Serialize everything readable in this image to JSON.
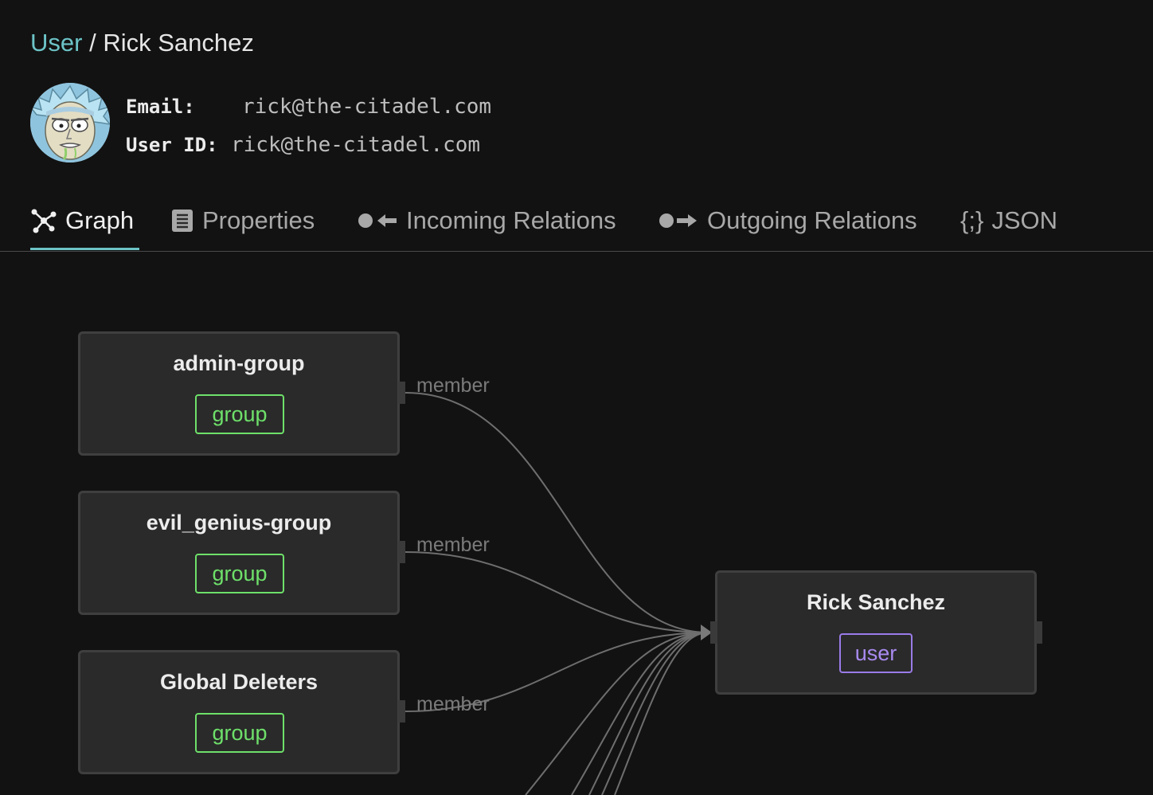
{
  "breadcrumb": {
    "parent": "User",
    "separator": "/",
    "current": "Rick Sanchez"
  },
  "profile": {
    "email_label": "Email:",
    "email_value": "rick@the-citadel.com",
    "userid_label": "User ID:",
    "userid_value": "rick@the-citadel.com"
  },
  "tabs": [
    {
      "label": "Graph",
      "icon": "graph-nodes-icon",
      "active": true
    },
    {
      "label": "Properties",
      "icon": "document-list-icon",
      "active": false
    },
    {
      "label": "Incoming Relations",
      "icon": "incoming-arrow-icon",
      "active": false
    },
    {
      "label": "Outgoing Relations",
      "icon": "outgoing-arrow-icon",
      "active": false
    },
    {
      "label": "JSON",
      "icon": "braces-icon",
      "prefix": "{;}",
      "active": false
    }
  ],
  "graph": {
    "nodes": [
      {
        "title": "admin-group",
        "type": "group"
      },
      {
        "title": "evil_genius-group",
        "type": "group"
      },
      {
        "title": "Global Deleters",
        "type": "group"
      }
    ],
    "target": {
      "title": "Rick Sanchez",
      "type": "user"
    },
    "edge_labels": [
      "member",
      "member",
      "member"
    ]
  },
  "colors": {
    "accent": "#6cc3c7",
    "group_badge": "#6ee06a",
    "user_badge": "#a98af0",
    "background": "#121212",
    "node_bg": "#2a2a2a"
  }
}
